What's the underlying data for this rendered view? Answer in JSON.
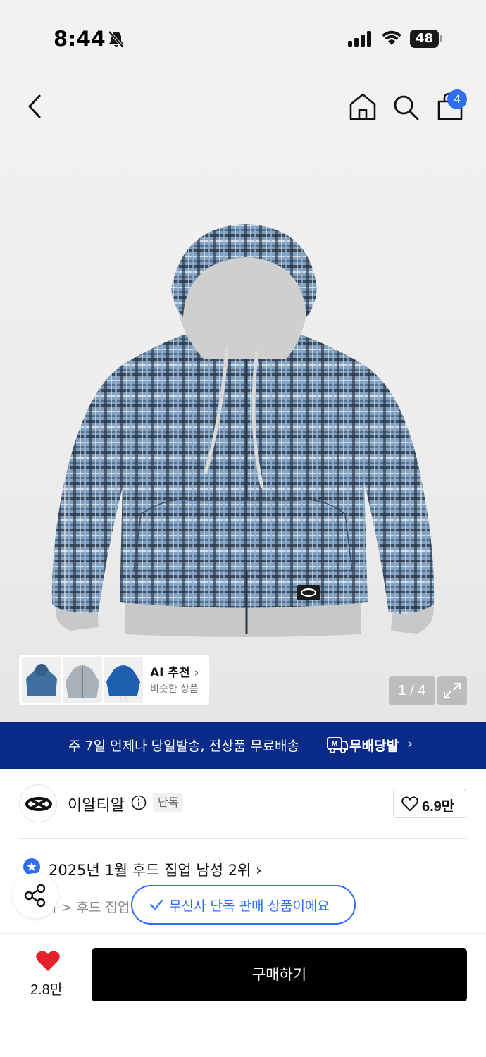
{
  "status_bar": {
    "time": "8:44",
    "battery": "48",
    "icons": [
      "bell-slash-icon",
      "cellular-signal-icon",
      "wifi-icon",
      "battery-icon"
    ]
  },
  "nav": {
    "icons": [
      "back-chevron-icon",
      "home-icon",
      "search-icon",
      "shopping-bag-icon"
    ],
    "cart_count": "4"
  },
  "gallery": {
    "pager": "1 / 4",
    "ai_recommend": {
      "title": "AI 추천",
      "subtitle": "비슷한 상품"
    }
  },
  "banner": {
    "text": "주 7일 언제나 당일발송, 전상품 무료배송",
    "badge_mark": "M",
    "badge_label": "무배당발"
  },
  "brand": {
    "name": "이알티알",
    "tag": "단독",
    "likes": "6.9만"
  },
  "ranking": {
    "text": "2025년 1월 후드 집업 남성 2위"
  },
  "breadcrumb": {
    "text": "아우터 > 후드 집업"
  },
  "toast": {
    "message": "무신사 단독 판매 상품이에요"
  },
  "bottom": {
    "wish_count": "2.8만",
    "buy_label": "구매하기"
  },
  "colors": {
    "accent_blue": "#2f6df6",
    "banner_navy": "#0a2a88",
    "heart_red": "#e8202a",
    "buy_button": "#000000"
  }
}
